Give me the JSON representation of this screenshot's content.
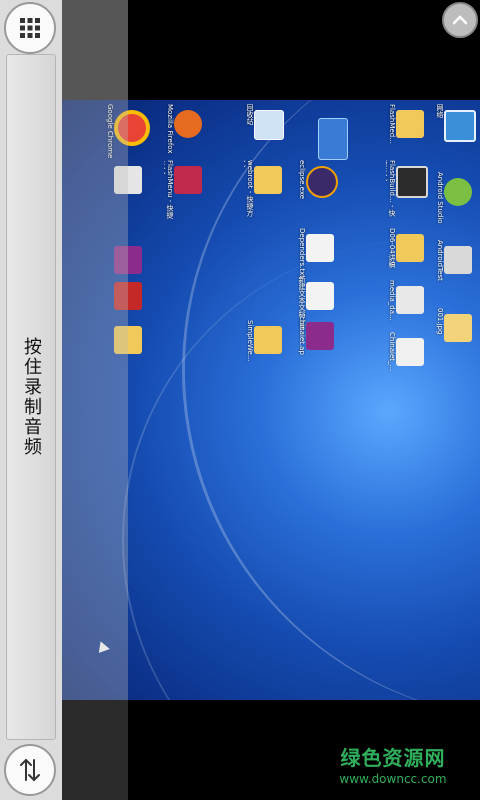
{
  "left_panel": {
    "record_label": "按住录制音频"
  },
  "watermark": {
    "title": "绿色资源网",
    "url": "www.downcc.com"
  },
  "desktop_icons": [
    {
      "label": "回收站"
    },
    {
      "label": "Mozilla Firefox"
    },
    {
      "label": "Google Chrome"
    },
    {
      "label": "webroot - 快捷方式"
    },
    {
      "label": "FlashMenu - 快捷方式"
    },
    {
      "label": "eclipse.exe"
    },
    {
      "label": "Dependers.txt"
    },
    {
      "label": "新建文本文档.txt"
    },
    {
      "label": "chinaiet.ap"
    },
    {
      "label": "SimpleWe..."
    },
    {
      "label": "FlashBuild... - 快捷方式"
    },
    {
      "label": "D06-04讲稿"
    },
    {
      "label": "media_da..."
    },
    {
      "label": "Chinaiet_..."
    },
    {
      "label": "Android Studio"
    },
    {
      "label": "AndroidTest"
    },
    {
      "label": "001.jpg"
    },
    {
      "label": "网络"
    },
    {
      "label": "FlashMed..."
    }
  ],
  "icons": {
    "menu": "grid-icon",
    "swap": "swap-arrows-icon",
    "up": "chevron-up-icon"
  }
}
